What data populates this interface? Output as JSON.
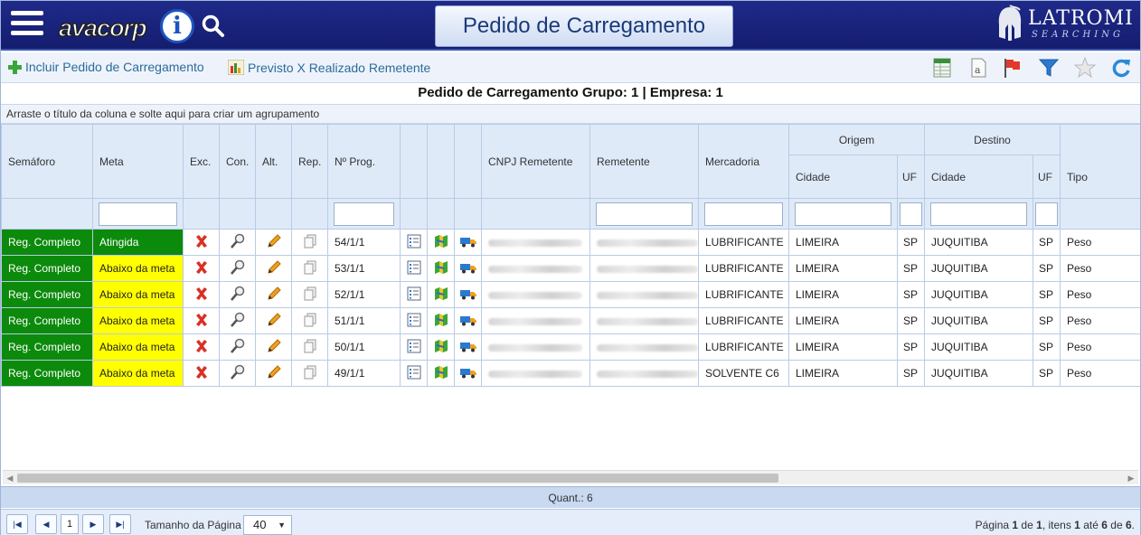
{
  "header": {
    "logo_text": "avacorp",
    "title": "Pedido de Carregamento",
    "brand_name": "LATROMI",
    "brand_sub": "SEARCHING"
  },
  "toolbar": {
    "include_label": "Incluir Pedido de Carregamento",
    "report_label": "Previsto X Realizado Remetente"
  },
  "grid": {
    "title": "Pedido de Carregamento Grupo: 1 | Empresa: 1",
    "group_hint": "Arraste o título da coluna e solte aqui para criar um agrupamento",
    "columns": {
      "semaforo": "Semáforo",
      "meta": "Meta",
      "exc": "Exc.",
      "con": "Con.",
      "alt": "Alt.",
      "rep": "Rep.",
      "nprog": "Nº Prog.",
      "cnpj": "CNPJ Remetente",
      "remetente": "Remetente",
      "mercadoria": "Mercadoria",
      "origem": "Origem",
      "destino": "Destino",
      "cidade": "Cidade",
      "uf": "UF",
      "tipo": "Tipo"
    },
    "rows": [
      {
        "semaforo": "Reg. Completo",
        "meta": "Atingida",
        "meta_status": "ok",
        "nprog": "54/1/1",
        "mercadoria": "LUBRIFICANTE",
        "origem_cidade": "LIMEIRA",
        "origem_uf": "SP",
        "destino_cidade": "JUQUITIBA",
        "destino_uf": "SP",
        "tipo": "Peso"
      },
      {
        "semaforo": "Reg. Completo",
        "meta": "Abaixo da meta",
        "meta_status": "low",
        "nprog": "53/1/1",
        "mercadoria": "LUBRIFICANTE",
        "origem_cidade": "LIMEIRA",
        "origem_uf": "SP",
        "destino_cidade": "JUQUITIBA",
        "destino_uf": "SP",
        "tipo": "Peso"
      },
      {
        "semaforo": "Reg. Completo",
        "meta": "Abaixo da meta",
        "meta_status": "low",
        "nprog": "52/1/1",
        "mercadoria": "LUBRIFICANTE",
        "origem_cidade": "LIMEIRA",
        "origem_uf": "SP",
        "destino_cidade": "JUQUITIBA",
        "destino_uf": "SP",
        "tipo": "Peso"
      },
      {
        "semaforo": "Reg. Completo",
        "meta": "Abaixo da meta",
        "meta_status": "low",
        "nprog": "51/1/1",
        "mercadoria": "LUBRIFICANTE",
        "origem_cidade": "LIMEIRA",
        "origem_uf": "SP",
        "destino_cidade": "JUQUITIBA",
        "destino_uf": "SP",
        "tipo": "Peso"
      },
      {
        "semaforo": "Reg. Completo",
        "meta": "Abaixo da meta",
        "meta_status": "low",
        "nprog": "50/1/1",
        "mercadoria": "LUBRIFICANTE",
        "origem_cidade": "LIMEIRA",
        "origem_uf": "SP",
        "destino_cidade": "JUQUITIBA",
        "destino_uf": "SP",
        "tipo": "Peso"
      },
      {
        "semaforo": "Reg. Completo",
        "meta": "Abaixo da meta",
        "meta_status": "low",
        "nprog": "49/1/1",
        "mercadoria": "SOLVENTE C6",
        "origem_cidade": "LIMEIRA",
        "origem_uf": "SP",
        "destino_cidade": "JUQUITIBA",
        "destino_uf": "SP",
        "tipo": "Peso"
      }
    ],
    "summary": "Quant.: 6"
  },
  "pager": {
    "current_page": "1",
    "page_size_label": "Tamanho da Página",
    "page_size": "40",
    "info_prefix": "Página",
    "info_page": "1",
    "info_of": "de",
    "info_total_pages": "1",
    "info_items": ", itens",
    "info_from": "1",
    "info_to_word": "até",
    "info_to": "6",
    "info_total": "6",
    "info_end": "."
  },
  "icons": {
    "delete": "delete-x-icon",
    "consult": "magnifier-icon",
    "edit": "pencil-icon",
    "copy": "copy-pages-icon",
    "details": "checklist-icon",
    "map": "map-icon",
    "truck": "truck-icon"
  },
  "colors": {
    "header_bg": "#1a248080",
    "semaforo_green": "#0c8a0c",
    "meta_yellow": "#ffff00",
    "grid_header": "#dfeaf8"
  }
}
